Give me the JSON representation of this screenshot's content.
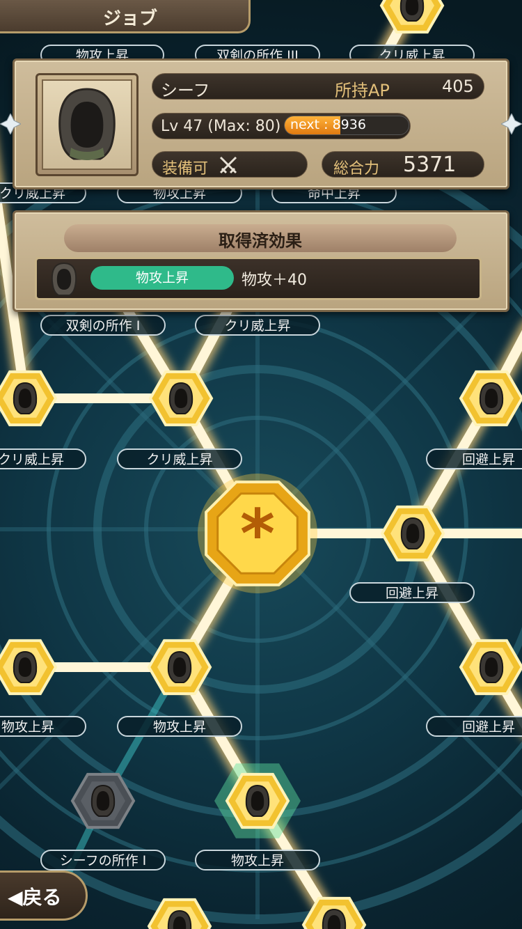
{
  "header": {
    "title": "ジョブ"
  },
  "status": {
    "job_name": "シーフ",
    "ap_label": "所持AP",
    "ap_value": "405",
    "level_text": "Lv 47 (Max: 80)",
    "next_label": "next : 8936",
    "next_progress": 0.45,
    "equip_label": "装備可",
    "total_label": "総合力",
    "total_value": "5371"
  },
  "effects": {
    "title": "取得済効果",
    "items": [
      {
        "name": "物攻上昇",
        "value": "物攻＋40"
      }
    ]
  },
  "board": {
    "labels": [
      {
        "text": "物攻上昇"
      },
      {
        "text": "双剣の所作 III"
      },
      {
        "text": "クリ威上昇"
      },
      {
        "text": "クリ威上昇"
      },
      {
        "text": "物攻上昇"
      },
      {
        "text": "命中上昇"
      },
      {
        "text": "双剣の所作 I"
      },
      {
        "text": "クリ威上昇"
      },
      {
        "text": "クリ威上昇"
      },
      {
        "text": "クリ威上昇"
      },
      {
        "text": "回避上昇"
      },
      {
        "text": "回避上昇"
      },
      {
        "text": "物攻上昇"
      },
      {
        "text": "物攻上昇"
      },
      {
        "text": "回避上昇"
      },
      {
        "text": "シーフの所作 I"
      },
      {
        "text": "物攻上昇"
      }
    ]
  },
  "footer": {
    "back_label": "◀戻る"
  },
  "colors": {
    "node_gold": "#f2c230",
    "node_locked": "#4a4f55",
    "effect_badge": "#2fba8a",
    "path": "#fff6d8"
  }
}
